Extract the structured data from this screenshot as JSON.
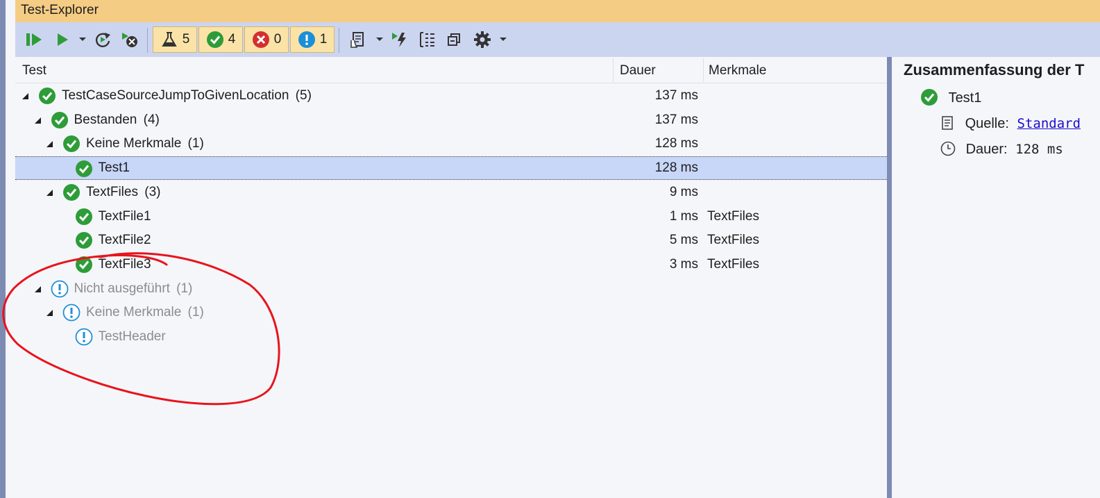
{
  "window": {
    "title": "Test-Explorer"
  },
  "toolbar": {
    "buttons": [
      {
        "icon": "run-all-icon"
      },
      {
        "icon": "run-icon"
      },
      {
        "icon": "rerun-icon"
      },
      {
        "icon": "cancel-icon"
      },
      {
        "icon": "playlist-icon"
      },
      {
        "icon": "live-unit-testing-icon"
      },
      {
        "icon": "group-by-icon"
      },
      {
        "icon": "collapse-all-icon"
      },
      {
        "icon": "settings-icon"
      }
    ],
    "counters": [
      {
        "name": "total",
        "value": "5",
        "icon": "flask-icon"
      },
      {
        "name": "passed",
        "value": "4",
        "icon": "passed-icon"
      },
      {
        "name": "failed",
        "value": "0",
        "icon": "failed-icon"
      },
      {
        "name": "not-run",
        "value": "1",
        "icon": "warning-icon"
      }
    ]
  },
  "columns": {
    "test": "Test",
    "duration": "Dauer",
    "traits": "Merkmale"
  },
  "rows": [
    {
      "label": "TestCaseSourceJumpToGivenLocation",
      "count": "(5)",
      "duration": "137 ms",
      "trait": "",
      "status": "passed"
    },
    {
      "label": "Bestanden",
      "count": "(4)",
      "duration": "137 ms",
      "trait": "",
      "status": "passed"
    },
    {
      "label": "Keine Merkmale",
      "count": "(1)",
      "duration": "128 ms",
      "trait": "",
      "status": "passed"
    },
    {
      "label": "Test1",
      "count": "",
      "duration": "128 ms",
      "trait": "",
      "status": "passed"
    },
    {
      "label": "TextFiles",
      "count": "(3)",
      "duration": "9 ms",
      "trait": "",
      "status": "passed"
    },
    {
      "label": "TextFile1",
      "count": "",
      "duration": "1 ms",
      "trait": "TextFiles",
      "status": "passed"
    },
    {
      "label": "TextFile2",
      "count": "",
      "duration": "5 ms",
      "trait": "TextFiles",
      "status": "passed"
    },
    {
      "label": "TextFile3",
      "count": "",
      "duration": "3 ms",
      "trait": "TextFiles",
      "status": "passed"
    },
    {
      "label": "Nicht ausgeführt",
      "count": "(1)",
      "duration": "",
      "trait": "",
      "status": "notrun"
    },
    {
      "label": "Keine Merkmale",
      "count": "(1)",
      "duration": "",
      "trait": "",
      "status": "notrun"
    },
    {
      "label": "TestHeader",
      "count": "",
      "duration": "",
      "trait": "",
      "status": "notrun"
    }
  ],
  "summary": {
    "title": "Zusammenfassung der T",
    "test_name": "Test1",
    "source_label": "Quelle:",
    "source_link": "Standard",
    "duration_label": "Dauer:",
    "duration_value": "128 ms"
  },
  "colors": {
    "title_bar": "#f5cc84",
    "toolbar": "#ccd5f0",
    "selection": "#c8d6f8",
    "passed": "#2e9c39",
    "failed": "#d32f2f",
    "not_run": "#1e8fd6",
    "annotation": "#e8141c"
  }
}
